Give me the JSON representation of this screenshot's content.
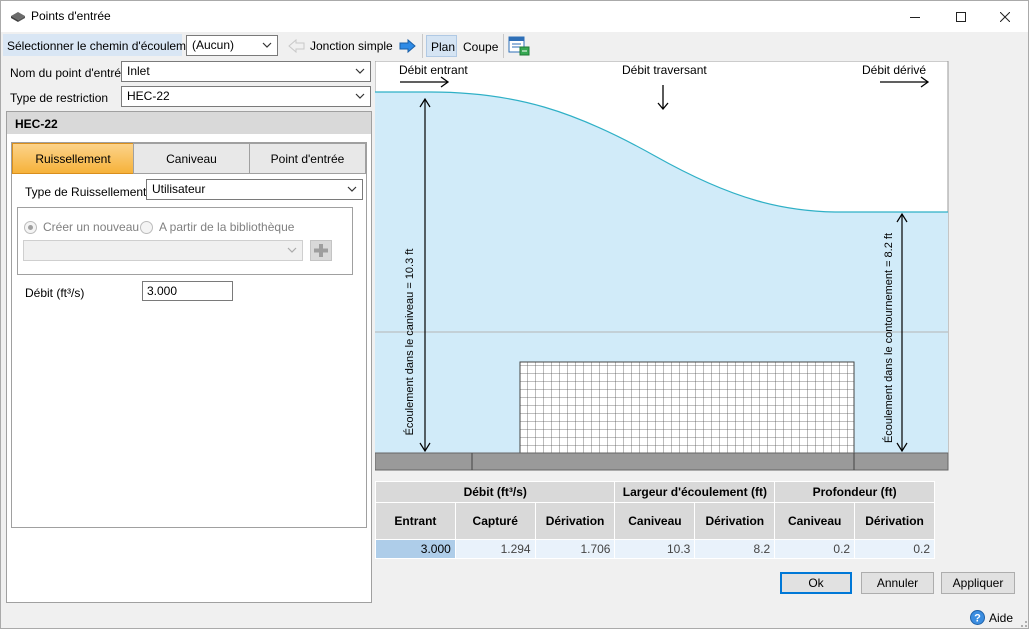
{
  "window": {
    "title": "Points d'entrée",
    "controls": [
      "minimize",
      "maximize",
      "close"
    ]
  },
  "toolbar": {
    "flow_path_label": "Sélectionner le chemin d'écoulement",
    "flow_path_value": "(Aucun)",
    "junction_label": "Jonction simple",
    "plan_label": "Plan",
    "section_label": "Coupe"
  },
  "form": {
    "inlet_name_label": "Nom du point d'entrée",
    "inlet_name_value": "Inlet",
    "restriction_label": "Type de restriction",
    "restriction_value": "HEC-22"
  },
  "panel": {
    "header": "HEC-22",
    "tabs": [
      {
        "label": "Ruissellement",
        "active": true
      },
      {
        "label": "Caniveau",
        "active": false
      },
      {
        "label": "Point d'entrée",
        "active": false
      }
    ],
    "runoff_type_label": "Type de Ruissellement",
    "runoff_type_value": "Utilisateur",
    "radio_new": "Créer un nouveau",
    "radio_library": "A partir de la bibliothèque",
    "library_value": "",
    "flow_label": "Débit (ft³/s)",
    "flow_value": "3.000"
  },
  "diagram": {
    "label_incoming": "Débit entrant",
    "label_through": "Débit traversant",
    "label_bypass": "Débit dérivé",
    "label_gutter_flow": "Écoulement dans le caniveau  =  10.3 ft",
    "label_bypass_flow": "Écoulement dans le contournement  =  8.2 ft",
    "colors": {
      "water": "#d1ebf9",
      "water_line": "#2fb0c6",
      "ground": "#9a9a9a"
    }
  },
  "results": {
    "group_headers": [
      "Débit (ft³/s)",
      "Largeur d'écoulement (ft)",
      "Profondeur (ft)"
    ],
    "columns": [
      "Entrant",
      "Capturé",
      "Dérivation",
      "Caniveau",
      "Dérivation",
      "Caniveau",
      "Dérivation"
    ],
    "row": [
      "3.000",
      "1.294",
      "1.706",
      "10.3",
      "8.2",
      "0.2",
      "0.2"
    ]
  },
  "buttons": {
    "ok": "Ok",
    "cancel": "Annuler",
    "apply": "Appliquer",
    "help": "Aide"
  }
}
